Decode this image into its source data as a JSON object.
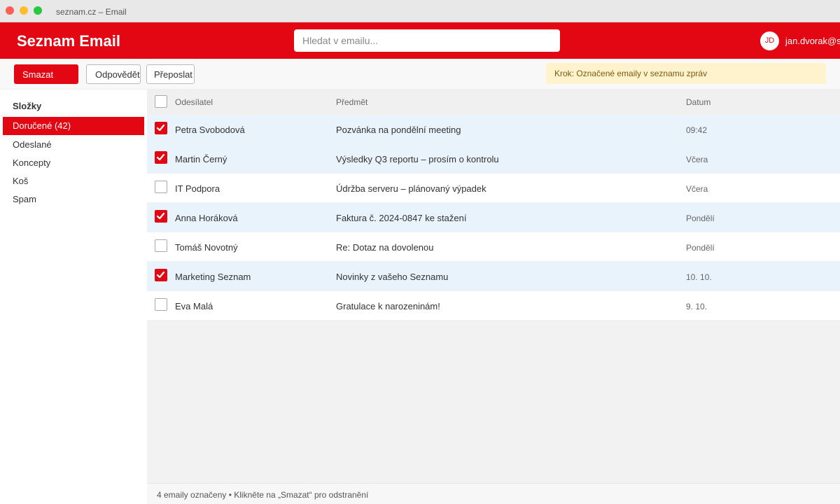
{
  "window": {
    "title": "seznam.cz – Email"
  },
  "header": {
    "brand": "Seznam Email",
    "search_placeholder": "Hledat v emailu...",
    "avatar_initials": "JD",
    "user_email": "jan.dvorak@seznam.cz",
    "brand_color": "#e30613"
  },
  "toolbar": {
    "delete_label": "Smazat",
    "reply_label": "Odpovědět",
    "forward_label": "Přeposlat",
    "hint": "Krok: Označené emaily v seznamu zpráv"
  },
  "sidebar": {
    "title": "Složky",
    "items": [
      {
        "label": "Doručené (42)",
        "active": true
      },
      {
        "label": "Odeslané",
        "active": false
      },
      {
        "label": "Koncepty",
        "active": false
      },
      {
        "label": "Koš",
        "active": false
      },
      {
        "label": "Spam",
        "active": false
      }
    ]
  },
  "list": {
    "columns": {
      "sender": "Odesílatel",
      "subject": "Předmět",
      "date": "Datum"
    },
    "rows": [
      {
        "sender": "Petra Svobodová",
        "subject": "Pozvánka na pondělní meeting",
        "date": "09:42",
        "checked": true
      },
      {
        "sender": "Martin Černý",
        "subject": "Výsledky Q3 reportu – prosím o kontrolu",
        "date": "Včera",
        "checked": true
      },
      {
        "sender": "IT Podpora",
        "subject": "Údržba serveru – plánovaný výpadek",
        "date": "Včera",
        "checked": false
      },
      {
        "sender": "Anna Horáková",
        "subject": "Faktura č. 2024-0847 ke stažení",
        "date": "Pondělí",
        "checked": true
      },
      {
        "sender": "Tomáš Novotný",
        "subject": "Re: Dotaz na dovolenou",
        "date": "Pondělí",
        "checked": false
      },
      {
        "sender": "Marketing Seznam",
        "subject": "Novinky z vašeho Seznamu",
        "date": "10. 10.",
        "checked": true
      },
      {
        "sender": "Eva Malá",
        "subject": "Gratulace k narozeninám!",
        "date": "9. 10.",
        "checked": false
      }
    ]
  },
  "status": {
    "text": "4 emaily označeny • Klikněte na „Smazat“ pro odstranění"
  }
}
